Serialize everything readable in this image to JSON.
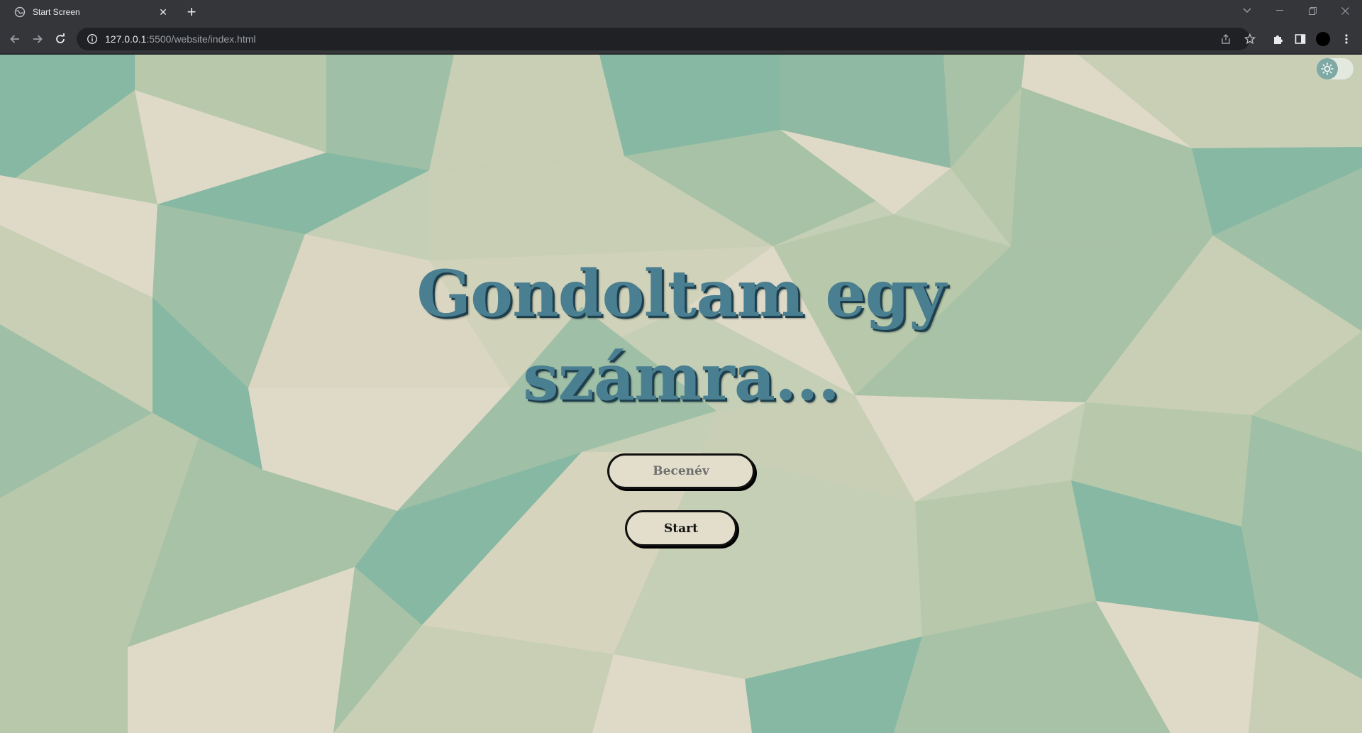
{
  "browser": {
    "tab_title": "Start Screen",
    "url_host": "127.0.0.1",
    "url_rest": ":5500/website/index.html",
    "icons": [
      "globe-icon",
      "close-icon",
      "new-tab-icon",
      "tab-search-icon",
      "minimize-icon",
      "restore-icon",
      "window-close-icon",
      "back-icon",
      "forward-icon",
      "reload-icon",
      "site-info-icon",
      "share-icon",
      "bookmark-star-icon",
      "extensions-icon",
      "side-panel-icon",
      "avatar",
      "kebab-menu-icon"
    ]
  },
  "page": {
    "heading_line1": "Gondoltam egy",
    "heading_line2": "számra...",
    "nickname_placeholder": "Becenév",
    "nickname_value": "",
    "start_label": "Start",
    "theme_toggle_icon": "sun-icon",
    "theme_mode": "light",
    "colors": {
      "heading": "#4a7f91",
      "heading_shadow": "#1d3f4d",
      "button_bg": "#e3decb",
      "button_border": "#111111",
      "bg_light": "#dedac8",
      "bg_sage": "#b8c9ab",
      "bg_teal": "#86b8a3"
    }
  }
}
